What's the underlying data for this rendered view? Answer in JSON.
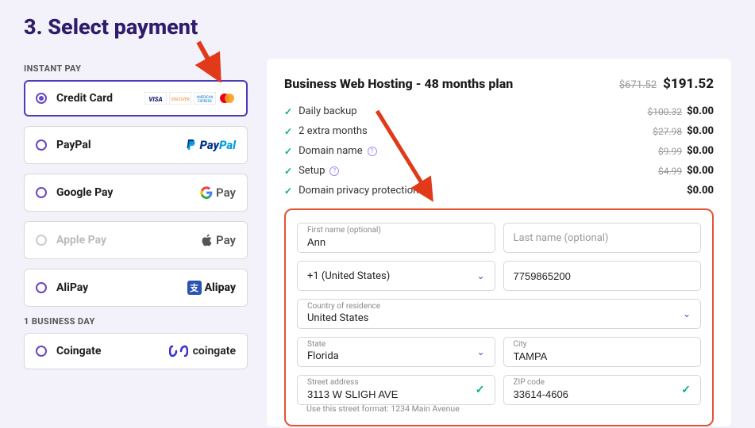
{
  "title": "3. Select payment",
  "groups": {
    "instant": "INSTANT PAY",
    "business": "1 BUSINESS DAY"
  },
  "options": {
    "credit": "Credit Card",
    "paypal": "PayPal",
    "gpay": "Google Pay",
    "apay": "Apple Pay",
    "alipay": "AliPay",
    "coingate": "Coingate"
  },
  "logos": {
    "gpay": "Pay",
    "apay": "Pay",
    "alipay": "Alipay",
    "coingate": "coingate"
  },
  "plan": {
    "title": "Business Web Hosting - 48 months plan",
    "orig": "$671.52",
    "now": "$191.52"
  },
  "items": [
    {
      "label": "Daily backup",
      "orig": "$100.32",
      "now": "$0.00",
      "info": false
    },
    {
      "label": "2 extra months",
      "orig": "$27.98",
      "now": "$0.00",
      "info": false
    },
    {
      "label": "Domain name",
      "orig": "$9.99",
      "now": "$0.00",
      "info": true
    },
    {
      "label": "Setup",
      "orig": "$4.99",
      "now": "$0.00",
      "info": true
    },
    {
      "label": "Domain privacy protection",
      "orig": "",
      "now": "$0.00",
      "info": false
    }
  ],
  "form": {
    "first_label": "First name (optional)",
    "first_value": "Ann",
    "last_placeholder": "Last name (optional)",
    "phone_cc": "+1 (United States)",
    "phone_value": "7759865200",
    "country_label": "Country of residence",
    "country_value": "United States",
    "state_label": "State",
    "state_value": "Florida",
    "city_label": "City",
    "city_value": "TAMPA",
    "street_label": "Street address",
    "street_value": "3113 W SLIGH AVE",
    "zip_label": "ZIP code",
    "zip_value": "33614-4606",
    "street_hint": "Use this street format: 1234 Main Avenue"
  }
}
